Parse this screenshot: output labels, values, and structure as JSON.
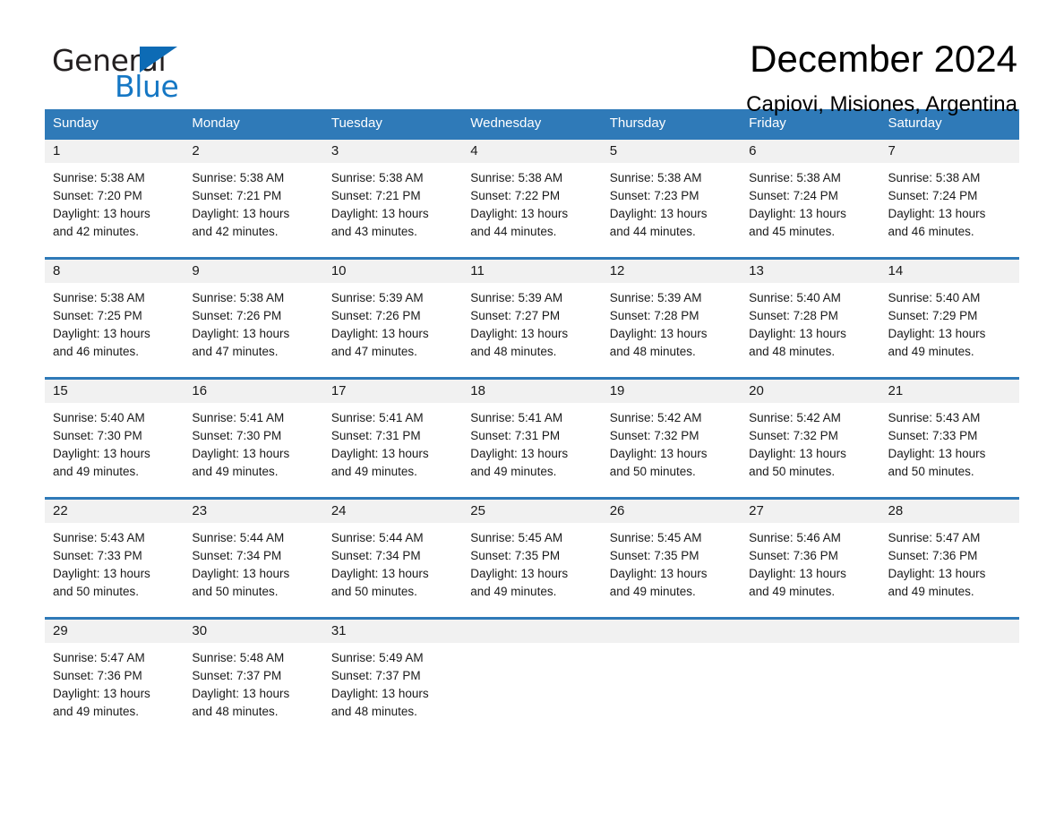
{
  "logo": {
    "word_one": "General",
    "word_two": "Blue",
    "triangle_icon": "triangle-icon",
    "brand_blue": "#1577c4",
    "brand_dark": "#231f20"
  },
  "header": {
    "month_title": "December 2024",
    "location": "Capiovi, Misiones, Argentina"
  },
  "theme": {
    "header_blue": "#2f7ab8",
    "day_band_gray": "#f1f1f1",
    "text_dark": "#1a1a1a"
  },
  "weekdays": [
    "Sunday",
    "Monday",
    "Tuesday",
    "Wednesday",
    "Thursday",
    "Friday",
    "Saturday"
  ],
  "weeks": [
    [
      {
        "date": "1",
        "sunrise": "Sunrise: 5:38 AM",
        "sunset": "Sunset: 7:20 PM",
        "daylight_line1": "Daylight: 13 hours",
        "daylight_line2": "and 42 minutes."
      },
      {
        "date": "2",
        "sunrise": "Sunrise: 5:38 AM",
        "sunset": "Sunset: 7:21 PM",
        "daylight_line1": "Daylight: 13 hours",
        "daylight_line2": "and 42 minutes."
      },
      {
        "date": "3",
        "sunrise": "Sunrise: 5:38 AM",
        "sunset": "Sunset: 7:21 PM",
        "daylight_line1": "Daylight: 13 hours",
        "daylight_line2": "and 43 minutes."
      },
      {
        "date": "4",
        "sunrise": "Sunrise: 5:38 AM",
        "sunset": "Sunset: 7:22 PM",
        "daylight_line1": "Daylight: 13 hours",
        "daylight_line2": "and 44 minutes."
      },
      {
        "date": "5",
        "sunrise": "Sunrise: 5:38 AM",
        "sunset": "Sunset: 7:23 PM",
        "daylight_line1": "Daylight: 13 hours",
        "daylight_line2": "and 44 minutes."
      },
      {
        "date": "6",
        "sunrise": "Sunrise: 5:38 AM",
        "sunset": "Sunset: 7:24 PM",
        "daylight_line1": "Daylight: 13 hours",
        "daylight_line2": "and 45 minutes."
      },
      {
        "date": "7",
        "sunrise": "Sunrise: 5:38 AM",
        "sunset": "Sunset: 7:24 PM",
        "daylight_line1": "Daylight: 13 hours",
        "daylight_line2": "and 46 minutes."
      }
    ],
    [
      {
        "date": "8",
        "sunrise": "Sunrise: 5:38 AM",
        "sunset": "Sunset: 7:25 PM",
        "daylight_line1": "Daylight: 13 hours",
        "daylight_line2": "and 46 minutes."
      },
      {
        "date": "9",
        "sunrise": "Sunrise: 5:38 AM",
        "sunset": "Sunset: 7:26 PM",
        "daylight_line1": "Daylight: 13 hours",
        "daylight_line2": "and 47 minutes."
      },
      {
        "date": "10",
        "sunrise": "Sunrise: 5:39 AM",
        "sunset": "Sunset: 7:26 PM",
        "daylight_line1": "Daylight: 13 hours",
        "daylight_line2": "and 47 minutes."
      },
      {
        "date": "11",
        "sunrise": "Sunrise: 5:39 AM",
        "sunset": "Sunset: 7:27 PM",
        "daylight_line1": "Daylight: 13 hours",
        "daylight_line2": "and 48 minutes."
      },
      {
        "date": "12",
        "sunrise": "Sunrise: 5:39 AM",
        "sunset": "Sunset: 7:28 PM",
        "daylight_line1": "Daylight: 13 hours",
        "daylight_line2": "and 48 minutes."
      },
      {
        "date": "13",
        "sunrise": "Sunrise: 5:40 AM",
        "sunset": "Sunset: 7:28 PM",
        "daylight_line1": "Daylight: 13 hours",
        "daylight_line2": "and 48 minutes."
      },
      {
        "date": "14",
        "sunrise": "Sunrise: 5:40 AM",
        "sunset": "Sunset: 7:29 PM",
        "daylight_line1": "Daylight: 13 hours",
        "daylight_line2": "and 49 minutes."
      }
    ],
    [
      {
        "date": "15",
        "sunrise": "Sunrise: 5:40 AM",
        "sunset": "Sunset: 7:30 PM",
        "daylight_line1": "Daylight: 13 hours",
        "daylight_line2": "and 49 minutes."
      },
      {
        "date": "16",
        "sunrise": "Sunrise: 5:41 AM",
        "sunset": "Sunset: 7:30 PM",
        "daylight_line1": "Daylight: 13 hours",
        "daylight_line2": "and 49 minutes."
      },
      {
        "date": "17",
        "sunrise": "Sunrise: 5:41 AM",
        "sunset": "Sunset: 7:31 PM",
        "daylight_line1": "Daylight: 13 hours",
        "daylight_line2": "and 49 minutes."
      },
      {
        "date": "18",
        "sunrise": "Sunrise: 5:41 AM",
        "sunset": "Sunset: 7:31 PM",
        "daylight_line1": "Daylight: 13 hours",
        "daylight_line2": "and 49 minutes."
      },
      {
        "date": "19",
        "sunrise": "Sunrise: 5:42 AM",
        "sunset": "Sunset: 7:32 PM",
        "daylight_line1": "Daylight: 13 hours",
        "daylight_line2": "and 50 minutes."
      },
      {
        "date": "20",
        "sunrise": "Sunrise: 5:42 AM",
        "sunset": "Sunset: 7:32 PM",
        "daylight_line1": "Daylight: 13 hours",
        "daylight_line2": "and 50 minutes."
      },
      {
        "date": "21",
        "sunrise": "Sunrise: 5:43 AM",
        "sunset": "Sunset: 7:33 PM",
        "daylight_line1": "Daylight: 13 hours",
        "daylight_line2": "and 50 minutes."
      }
    ],
    [
      {
        "date": "22",
        "sunrise": "Sunrise: 5:43 AM",
        "sunset": "Sunset: 7:33 PM",
        "daylight_line1": "Daylight: 13 hours",
        "daylight_line2": "and 50 minutes."
      },
      {
        "date": "23",
        "sunrise": "Sunrise: 5:44 AM",
        "sunset": "Sunset: 7:34 PM",
        "daylight_line1": "Daylight: 13 hours",
        "daylight_line2": "and 50 minutes."
      },
      {
        "date": "24",
        "sunrise": "Sunrise: 5:44 AM",
        "sunset": "Sunset: 7:34 PM",
        "daylight_line1": "Daylight: 13 hours",
        "daylight_line2": "and 50 minutes."
      },
      {
        "date": "25",
        "sunrise": "Sunrise: 5:45 AM",
        "sunset": "Sunset: 7:35 PM",
        "daylight_line1": "Daylight: 13 hours",
        "daylight_line2": "and 49 minutes."
      },
      {
        "date": "26",
        "sunrise": "Sunrise: 5:45 AM",
        "sunset": "Sunset: 7:35 PM",
        "daylight_line1": "Daylight: 13 hours",
        "daylight_line2": "and 49 minutes."
      },
      {
        "date": "27",
        "sunrise": "Sunrise: 5:46 AM",
        "sunset": "Sunset: 7:36 PM",
        "daylight_line1": "Daylight: 13 hours",
        "daylight_line2": "and 49 minutes."
      },
      {
        "date": "28",
        "sunrise": "Sunrise: 5:47 AM",
        "sunset": "Sunset: 7:36 PM",
        "daylight_line1": "Daylight: 13 hours",
        "daylight_line2": "and 49 minutes."
      }
    ],
    [
      {
        "date": "29",
        "sunrise": "Sunrise: 5:47 AM",
        "sunset": "Sunset: 7:36 PM",
        "daylight_line1": "Daylight: 13 hours",
        "daylight_line2": "and 49 minutes."
      },
      {
        "date": "30",
        "sunrise": "Sunrise: 5:48 AM",
        "sunset": "Sunset: 7:37 PM",
        "daylight_line1": "Daylight: 13 hours",
        "daylight_line2": "and 48 minutes."
      },
      {
        "date": "31",
        "sunrise": "Sunrise: 5:49 AM",
        "sunset": "Sunset: 7:37 PM",
        "daylight_line1": "Daylight: 13 hours",
        "daylight_line2": "and 48 minutes."
      },
      {
        "date": "",
        "sunrise": "",
        "sunset": "",
        "daylight_line1": "",
        "daylight_line2": ""
      },
      {
        "date": "",
        "sunrise": "",
        "sunset": "",
        "daylight_line1": "",
        "daylight_line2": ""
      },
      {
        "date": "",
        "sunrise": "",
        "sunset": "",
        "daylight_line1": "",
        "daylight_line2": ""
      },
      {
        "date": "",
        "sunrise": "",
        "sunset": "",
        "daylight_line1": "",
        "daylight_line2": ""
      }
    ]
  ]
}
